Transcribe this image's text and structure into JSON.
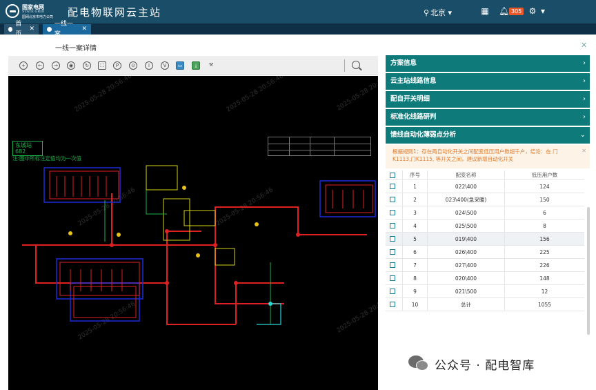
{
  "header": {
    "logo_cn": "国家电网",
    "logo_en": "STATE GRID",
    "logo_sub": "国网北京市电力公司",
    "app_title": "配电物联网云主站",
    "region": "北京",
    "notification_count": "305"
  },
  "tabs": [
    {
      "label": "首页"
    },
    {
      "label": "一线一案"
    }
  ],
  "page": {
    "title": "一线一案详情"
  },
  "diagram": {
    "station_name": "东城站",
    "station_code": "682",
    "note": "注:图中所标注定值均为一次值",
    "watermark": "2025-05-28 20:56:46"
  },
  "panel": {
    "sections": [
      {
        "label": "方案信息",
        "expanded": false
      },
      {
        "label": "云主站线路信息",
        "expanded": false
      },
      {
        "label": "配自开关明细",
        "expanded": false
      },
      {
        "label": "标准化线路研判",
        "expanded": false
      },
      {
        "label": "馈线自动化薄弱点分析",
        "expanded": true
      }
    ],
    "alert_text": "根据规则1：存在两自动化开关之间配变低压用户数超千户，结论：在 门K1113,门K1115, 等开关之间，建议新增自动化开关",
    "table": {
      "headers": [
        "序号",
        "配变名称",
        "低压用户数"
      ],
      "rows": [
        {
          "no": "1",
          "name": "022\\400",
          "users": "124"
        },
        {
          "no": "2",
          "name": "023\\400(急采暖)",
          "users": "150"
        },
        {
          "no": "3",
          "name": "024\\500",
          "users": "6"
        },
        {
          "no": "4",
          "name": "025\\500",
          "users": "8"
        },
        {
          "no": "5",
          "name": "019\\400",
          "users": "156"
        },
        {
          "no": "6",
          "name": "026\\400",
          "users": "225"
        },
        {
          "no": "7",
          "name": "027\\400",
          "users": "226"
        },
        {
          "no": "8",
          "name": "020\\400",
          "users": "148"
        },
        {
          "no": "9",
          "name": "021\\500",
          "users": "12"
        },
        {
          "no": "10",
          "name": "总计",
          "users": "1055"
        }
      ]
    }
  },
  "footer": {
    "wechat": "公众号 · 配电智库"
  },
  "colors": {
    "header_bg": "#1a4d68",
    "accordion_bg": "#0f7a7a",
    "alert_text": "#e07a2a",
    "diagram_bg": "#000000"
  }
}
